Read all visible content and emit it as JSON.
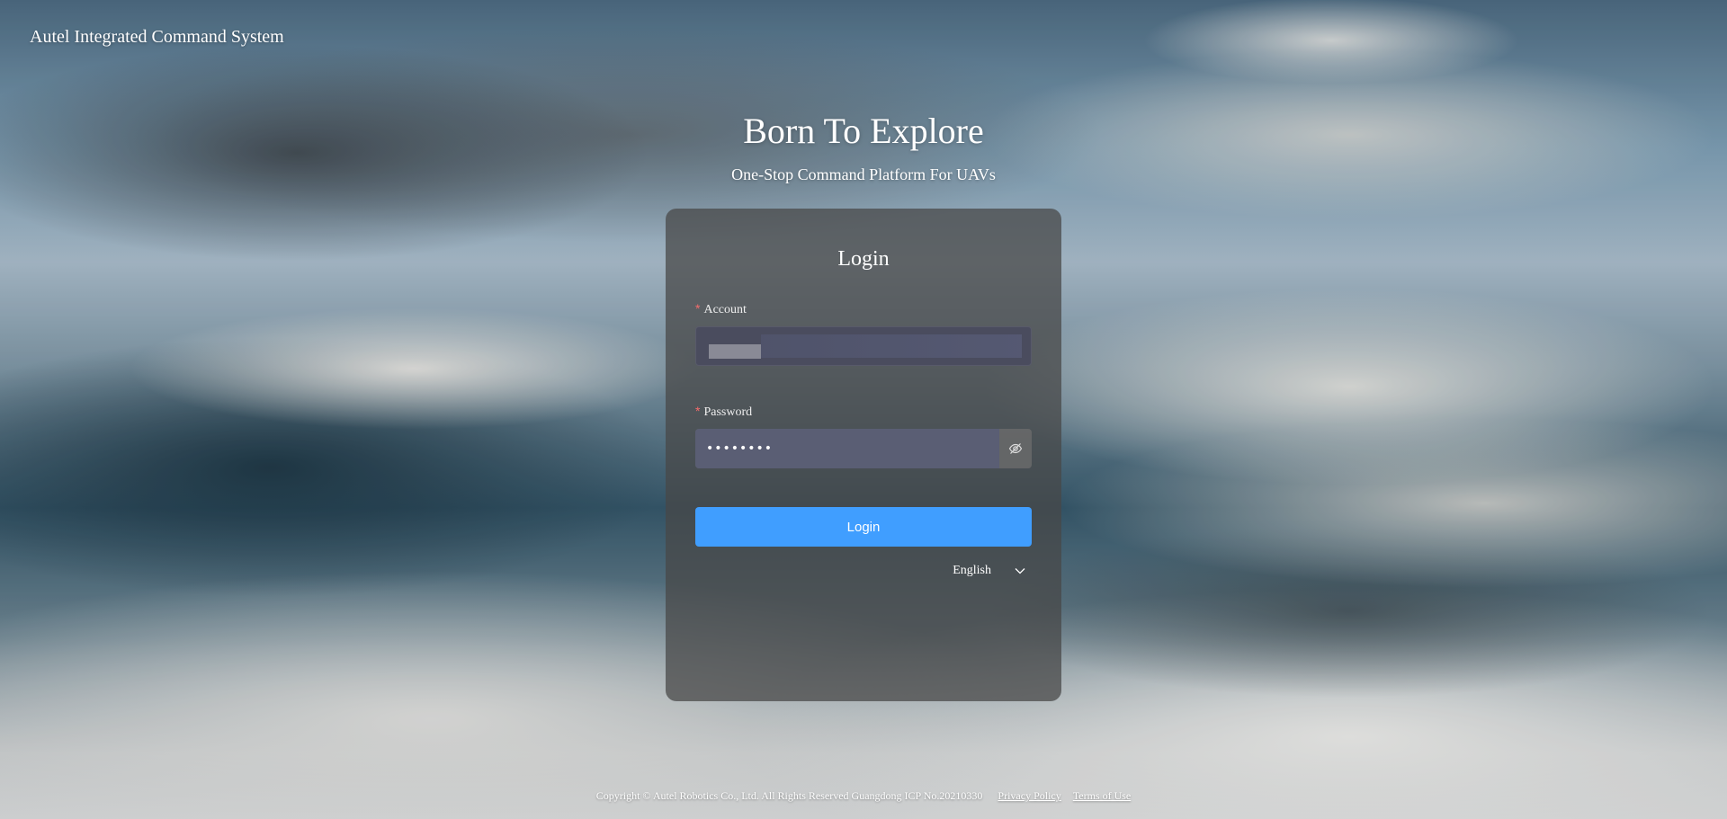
{
  "app": {
    "title": "Autel Integrated Command System"
  },
  "hero": {
    "title": "Born To Explore",
    "subtitle": "One-Stop Command Platform For UAVs"
  },
  "login_form": {
    "title": "Login",
    "required_mark": "*",
    "account": {
      "label": "Account"
    },
    "password": {
      "label": "Password",
      "value": "••••••••",
      "toggle_icon": "eye-slash-icon"
    },
    "submit_label": "Login",
    "language": {
      "selected": "English",
      "icon": "chevron-down-icon"
    }
  },
  "footer": {
    "copyright": "Copyright © Autel Robotics Co., Ltd. All Rights Reserved Guangdong ICP No.20210330",
    "privacy_link": "Privacy Policy",
    "terms_link": "Terms of Use"
  },
  "colors": {
    "primary_button": "#409eff",
    "required_mark": "#f56c6c",
    "card_background": "rgba(72,72,72,0.74)"
  }
}
